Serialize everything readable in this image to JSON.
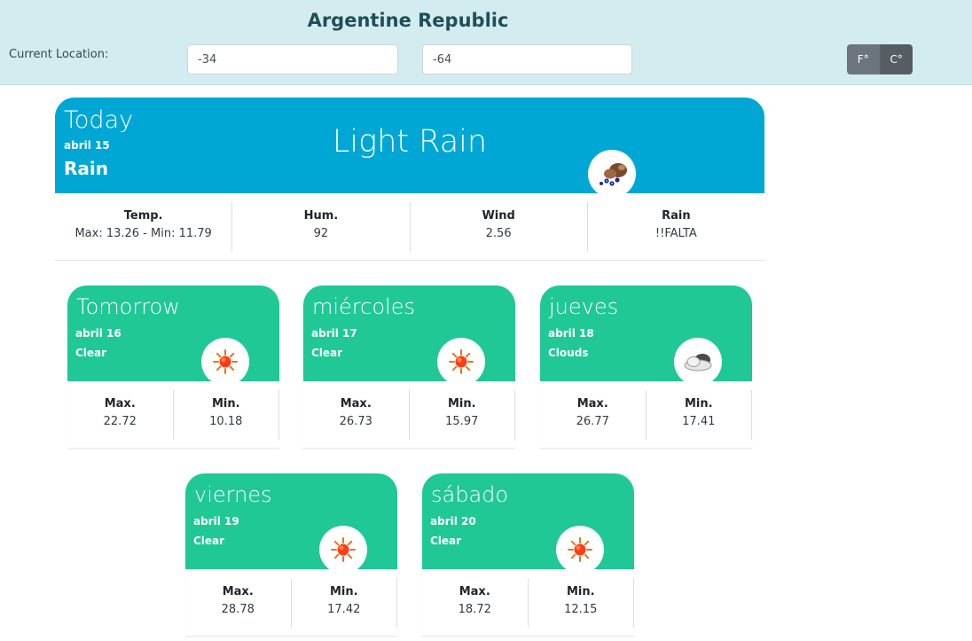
{
  "header": {
    "country": "Argentine Republic",
    "location_label": "Current Location:",
    "latitude": "-34",
    "longitude": "-64",
    "unit_f": "F°",
    "unit_c": "C°",
    "active_unit": "C"
  },
  "today": {
    "title": "Today",
    "date": "abril 15",
    "condition": "Rain",
    "description": "Light Rain",
    "icon": "light-rain-icon",
    "stats": [
      {
        "label": "Temp.",
        "value": "Max: 13.26 - Min: 11.79"
      },
      {
        "label": "Hum.",
        "value": "92"
      },
      {
        "label": "Wind",
        "value": "2.56"
      },
      {
        "label": "Rain",
        "value": "!!FALTA"
      }
    ]
  },
  "forecast": [
    {
      "day": "Tomorrow",
      "date": "abril 16",
      "condition": "Clear",
      "icon": "sun-icon",
      "max_label": "Max.",
      "max": "22.72",
      "min_label": "Min.",
      "min": "10.18"
    },
    {
      "day": "miércoles",
      "date": "abril 17",
      "condition": "Clear",
      "icon": "sun-icon",
      "max_label": "Max.",
      "max": "26.73",
      "min_label": "Min.",
      "min": "15.97"
    },
    {
      "day": "jueves",
      "date": "abril 18",
      "condition": "Clouds",
      "icon": "cloud-icon",
      "max_label": "Max.",
      "max": "26.77",
      "min_label": "Min.",
      "min": "17.41"
    },
    {
      "day": "viernes",
      "date": "abril 19",
      "condition": "Clear",
      "icon": "sun-icon",
      "max_label": "Max.",
      "max": "28.78",
      "min_label": "Min.",
      "min": "17.42"
    },
    {
      "day": "sábado",
      "date": "abril 20",
      "condition": "Clear",
      "icon": "sun-icon",
      "max_label": "Max.",
      "max": "18.72",
      "min_label": "Min.",
      "min": "12.15"
    }
  ],
  "colors": {
    "header_bg": "#d3ecef",
    "today_bg": "#01a7d4",
    "forecast_bg": "#20c896",
    "button_bg": "#6c757d"
  }
}
